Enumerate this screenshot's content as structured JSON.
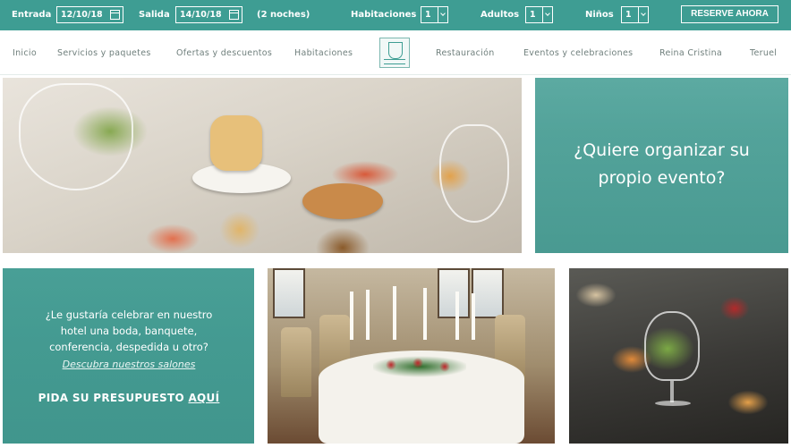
{
  "booking": {
    "checkin_label": "Entrada",
    "checkin_value": "12/10/18",
    "checkout_label": "Salida",
    "checkout_value": "14/10/18",
    "nights": "(2 noches)",
    "rooms_label": "Habitaciones",
    "rooms_value": "1",
    "adults_label": "Adultos",
    "adults_value": "1",
    "children_label": "Niños",
    "children_value": "1",
    "reserve_label": "RESERVE AHORA"
  },
  "nav": {
    "items": [
      "Inicio",
      "Servicios y paquetes",
      "Ofertas y descuentos",
      "Habitaciones",
      "Restauración",
      "Eventos y celebraciones",
      "Reina Cristina",
      "Teruel"
    ]
  },
  "event_card": {
    "line1": "¿Quiere organizar su",
    "line2": "propio evento?"
  },
  "promo": {
    "line1": "¿Le gustaría celebrar en nuestro",
    "line2": "hotel una boda, banquete,",
    "line3": "conferencia, despedida u otro?",
    "link": "Descubra nuestros salones",
    "cta_prefix": "PIDA SU PRESUPUESTO ",
    "cta_link": "AQUÍ"
  },
  "colors": {
    "teal": "#3e9d93",
    "nav_text": "#6f7f7c"
  }
}
